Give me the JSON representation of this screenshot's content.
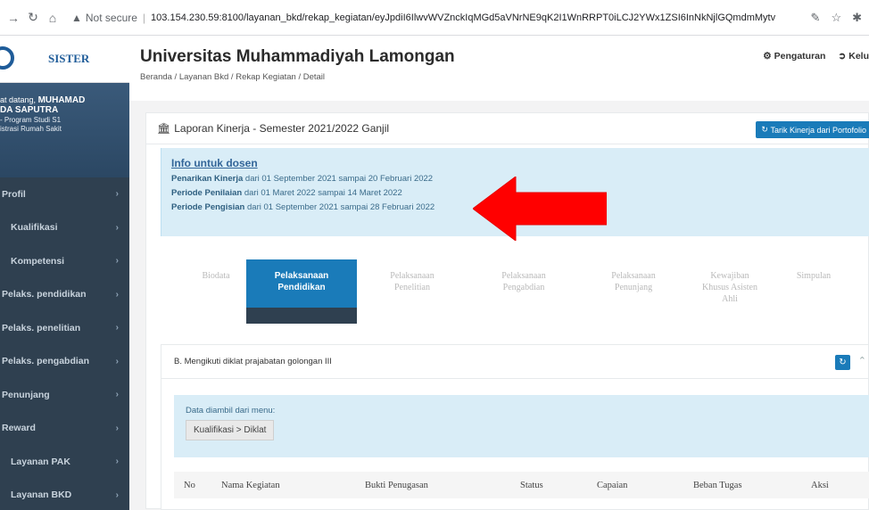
{
  "browser": {
    "security": "Not secure",
    "url": "103.154.230.59:8100/layanan_bkd/rekap_kegiatan/eyJpdiI6IlwvWVZnckIqMGd5aVNrNE9qK2I1WnRRPT0iLCJ2YWx1ZSI6InNkNjlGQmdmMytvaHQwUU..."
  },
  "sidebar": {
    "brand": "SISTER",
    "welcome_prefix": "at datang,",
    "welcome_name": "MUHAMAD",
    "name_line": "DA SAPUTRA",
    "program_line": "- Program Studi S1",
    "dept_line": "istrasi Rumah Sakit",
    "items": [
      {
        "label": "Profil"
      },
      {
        "label": "Kualifikasi"
      },
      {
        "label": "Kompetensi"
      },
      {
        "label": "Pelaks. pendidikan"
      },
      {
        "label": "Pelaks. penelitian"
      },
      {
        "label": "Pelaks. pengabdian"
      },
      {
        "label": "Penunjang"
      },
      {
        "label": "Reward"
      },
      {
        "label": "Layanan PAK"
      },
      {
        "label": "Layanan BKD"
      }
    ]
  },
  "header": {
    "title": "Universitas Muhammadiyah Lamongan",
    "breadcrumb": "Beranda  /  Layanan Bkd  /  Rekap Kegiatan  /  Detail",
    "settings": "Pengaturan",
    "logout": "Kelu"
  },
  "report": {
    "title": "Laporan Kinerja - Semester 2021/2022 Ganjil",
    "pull_button": "Tarik Kinerja dari Portofolio"
  },
  "info": {
    "title": "Info untuk dosen",
    "lines": [
      {
        "label": "Penarikan Kinerja",
        "text": " dari 01 September 2021 sampai 20 Februari 2022"
      },
      {
        "label": "Periode Penilaian",
        "text": " dari 01 Maret 2022 sampai 14 Maret 2022"
      },
      {
        "label": "Periode Pengisian",
        "text": " dari 01 September 2021 sampai 28 Februari 2022"
      }
    ]
  },
  "steps": [
    {
      "l1": "Biodata",
      "l2": "",
      "l3": ""
    },
    {
      "l1": "Pelaksanaan",
      "l2": "Pendidikan",
      "l3": ""
    },
    {
      "l1": "Pelaksanaan",
      "l2": "Penelitian",
      "l3": ""
    },
    {
      "l1": "Pelaksanaan",
      "l2": "Pengabdian",
      "l3": ""
    },
    {
      "l1": "Pelaksanaan",
      "l2": "Penunjang",
      "l3": ""
    },
    {
      "l1": "Kewajiban",
      "l2": "Khusus Asisten",
      "l3": "Ahli"
    },
    {
      "l1": "Simpulan",
      "l2": "",
      "l3": ""
    }
  ],
  "section": {
    "title": "B. Mengikuti diklat prajabatan golongan III",
    "source_label": "Data diambil dari menu:",
    "source_menu": "Kualifikasi > Diklat"
  },
  "table": {
    "columns": [
      "No",
      "Nama Kegiatan",
      "Bukti Penugasan",
      "Status",
      "Capaian",
      "Beban Tugas",
      "Aksi"
    ]
  },
  "colors": {
    "sidebar": "#2f4050",
    "primary": "#1a7bb9",
    "info_bg": "#d9edf7",
    "arrow": "#ff0000"
  }
}
